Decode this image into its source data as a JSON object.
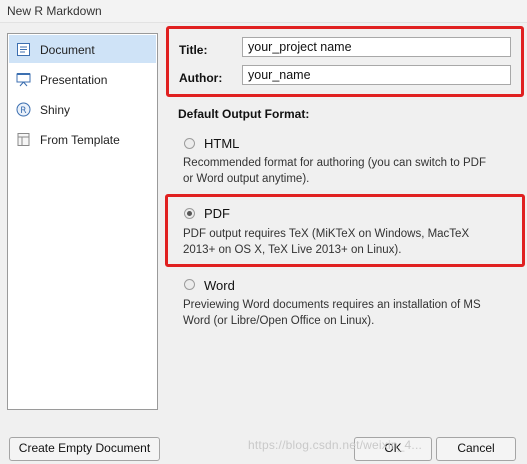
{
  "window": {
    "title": "New R Markdown"
  },
  "sidebar": {
    "items": [
      {
        "label": "Document",
        "icon": "document-icon",
        "selected": true
      },
      {
        "label": "Presentation",
        "icon": "presentation-icon",
        "selected": false
      },
      {
        "label": "Shiny",
        "icon": "shiny-icon",
        "selected": false
      },
      {
        "label": "From Template",
        "icon": "template-icon",
        "selected": false
      }
    ]
  },
  "fields": {
    "title_label": "Title:",
    "title_value": "your_project name",
    "author_label": "Author:",
    "author_value": "your_name"
  },
  "output": {
    "section_title": "Default Output Format:",
    "options": [
      {
        "label": "HTML",
        "desc_line1": "Recommended format for authoring (you can switch to PDF",
        "desc_line2": "or Word output anytime).",
        "selected": false
      },
      {
        "label": "PDF",
        "desc_line1": "PDF output requires TeX (MiKTeX on Windows, MacTeX",
        "desc_line2": "2013+ on OS X, TeX Live 2013+ on Linux).",
        "selected": true
      },
      {
        "label": "Word",
        "desc_line1": "Previewing Word documents requires an installation of MS",
        "desc_line2": "Word (or Libre/Open Office on Linux).",
        "selected": false
      }
    ]
  },
  "buttons": {
    "create_empty": "Create Empty Document",
    "ok": "OK",
    "cancel": "Cancel"
  },
  "watermark": "https://blog.csdn.net/weixin_4...",
  "colors": {
    "highlight": "#e02020",
    "sidebar_selected": "#cfe3f7"
  }
}
